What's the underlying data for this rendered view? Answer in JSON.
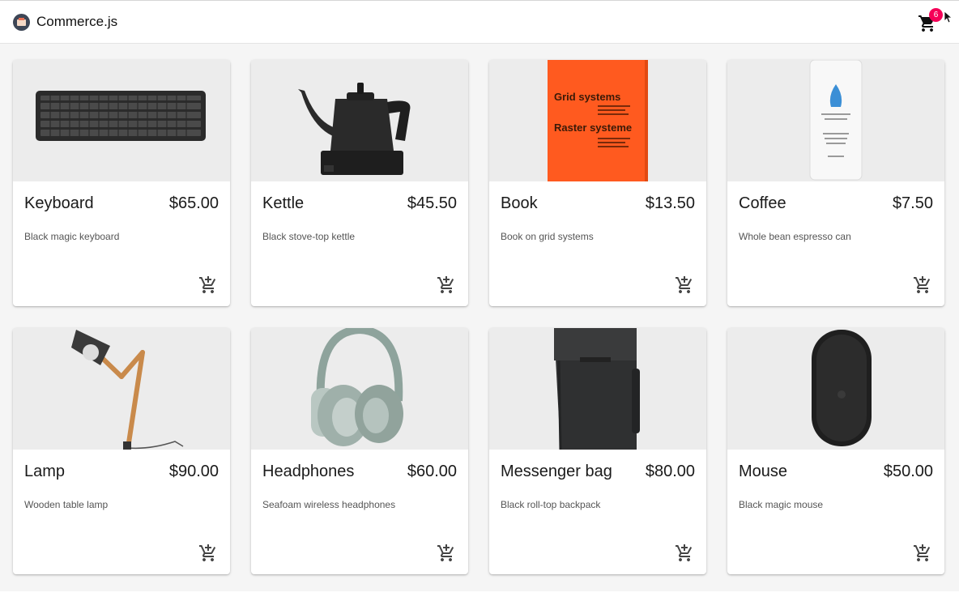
{
  "app": {
    "title": "Commerce.js",
    "logo_icon": "commercejs-logo-icon",
    "cart_icon": "shopping-cart-icon",
    "cart_count": "6"
  },
  "colors": {
    "badge": "#f50057",
    "background": "#f5f5f5",
    "book_cover": "#ff5a1f"
  },
  "products": [
    {
      "name": "Keyboard",
      "price": "$65.00",
      "description": "Black magic keyboard",
      "image": "keyboard"
    },
    {
      "name": "Kettle",
      "price": "$45.50",
      "description": "Black stove-top kettle",
      "image": "kettle"
    },
    {
      "name": "Book",
      "price": "$13.50",
      "description": "Book on grid systems",
      "image": "book",
      "cover_lines": [
        "Grid systems",
        "Raster systeme"
      ]
    },
    {
      "name": "Coffee",
      "price": "$7.50",
      "description": "Whole bean espresso can",
      "image": "coffee"
    },
    {
      "name": "Lamp",
      "price": "$90.00",
      "description": "Wooden table lamp",
      "image": "lamp"
    },
    {
      "name": "Headphones",
      "price": "$60.00",
      "description": "Seafoam wireless headphones",
      "image": "headphones"
    },
    {
      "name": "Messenger bag",
      "price": "$80.00",
      "description": "Black roll-top backpack",
      "image": "backpack"
    },
    {
      "name": "Mouse",
      "price": "$50.00",
      "description": "Black magic mouse",
      "image": "mouse"
    }
  ],
  "card_action_icon": "add-shopping-cart-icon"
}
